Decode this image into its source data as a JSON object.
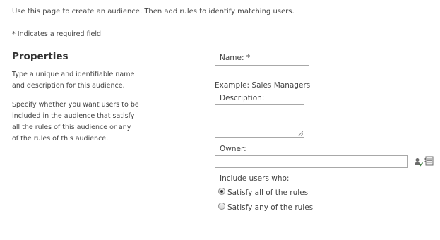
{
  "intro_text": "Use this page to create an audience. Then add rules to identify matching users.",
  "required_note": "* Indicates a required field",
  "properties": {
    "title": "Properties",
    "description1": "Type a unique and identifiable name and description for this audience.",
    "description2": "Specify whether you want users to be included in the audience that satisfy all the rules of this audience or any of the rules of this audience."
  },
  "form": {
    "name_label": "Name: *",
    "name_value": "",
    "name_example": "Example: Sales Managers",
    "description_label": "Description:",
    "description_value": "",
    "owner_label": "Owner:",
    "owner_value": "",
    "include_label": "Include users who:",
    "options": [
      {
        "label": "Satisfy all of the rules",
        "checked": true
      },
      {
        "label": "Satisfy any of the rules",
        "checked": false
      }
    ]
  },
  "icons": {
    "check_names": "check-names-icon",
    "browse": "address-book-icon"
  }
}
